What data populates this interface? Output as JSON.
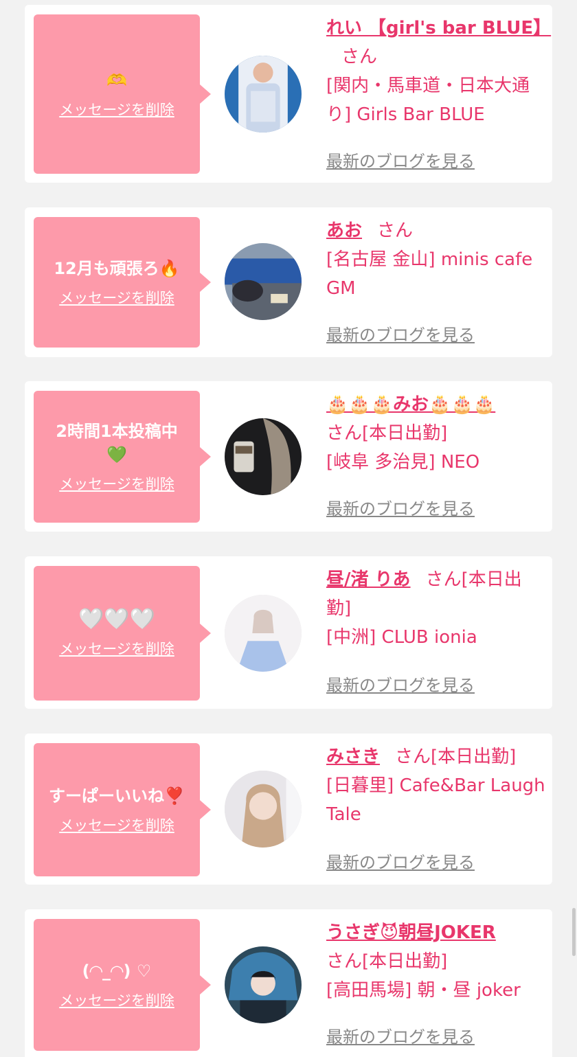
{
  "delete_label": "メッセージを削除",
  "blog_label": "最新のブログを見る",
  "colors": {
    "background": "#f2f2f2",
    "card": "#ffffff",
    "bubble": "#fd9aaa",
    "accent": "#e8366b",
    "link_gray": "#888888"
  },
  "items": [
    {
      "message": "🫶",
      "name": "れい 【girl's bar BLUE】",
      "suffix": "さん",
      "shop": "[関内・馬車道・日本大通り] Girls Bar BLUE"
    },
    {
      "message": "12月も頑張ろ🔥",
      "name": "あお",
      "suffix": "さん",
      "shop": "[名古屋 金山] minis cafe GM"
    },
    {
      "message": "2時間1本投稿中\n💚",
      "name": "🎂🎂🎂みお🎂🎂🎂",
      "suffix": "さん[本日出勤]",
      "shop": "[岐阜 多治見] NEO"
    },
    {
      "message": "🤍🤍🤍",
      "name": "昼/渚 りあ",
      "suffix": "さん[本日出勤]",
      "shop": "[中洲] CLUB ionia"
    },
    {
      "message": "すーぱーいいね❣️",
      "name": "みさき",
      "suffix": "さん[本日出勤]",
      "shop": "[日暮里] Cafe&Bar Laugh Tale"
    },
    {
      "message": "(◠_◠) ♡",
      "name": "うさぎ😈朝昼JOKER",
      "suffix": "さん[本日出勤]",
      "shop": "[高田馬場] 朝・昼 joker"
    }
  ]
}
